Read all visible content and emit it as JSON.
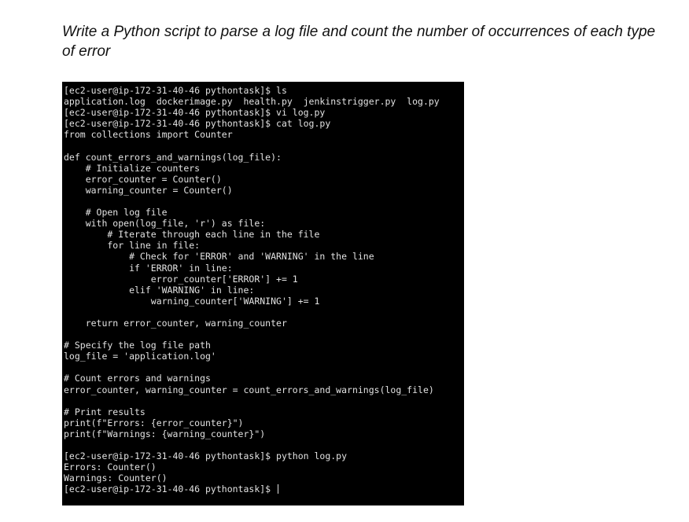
{
  "question": {
    "text": "Write a Python script to parse a log file and count the number of occurrences of each type of error"
  },
  "terminal": {
    "background_color": "#000000",
    "text_color": "#e2e2e2",
    "lines": [
      "[ec2-user@ip-172-31-40-46 pythontask]$ ls",
      "application.log  dockerimage.py  health.py  jenkinstrigger.py  log.py",
      "[ec2-user@ip-172-31-40-46 pythontask]$ vi log.py",
      "[ec2-user@ip-172-31-40-46 pythontask]$ cat log.py",
      "from collections import Counter",
      "",
      "def count_errors_and_warnings(log_file):",
      "    # Initialize counters",
      "    error_counter = Counter()",
      "    warning_counter = Counter()",
      "",
      "    # Open log file",
      "    with open(log_file, 'r') as file:",
      "        # Iterate through each line in the file",
      "        for line in file:",
      "            # Check for 'ERROR' and 'WARNING' in the line",
      "            if 'ERROR' in line:",
      "                error_counter['ERROR'] += 1",
      "            elif 'WARNING' in line:",
      "                warning_counter['WARNING'] += 1",
      "",
      "    return error_counter, warning_counter",
      "",
      "# Specify the log file path",
      "log_file = 'application.log'",
      "",
      "# Count errors and warnings",
      "error_counter, warning_counter = count_errors_and_warnings(log_file)",
      "",
      "# Print results",
      "print(f\"Errors: {error_counter}\")",
      "print(f\"Warnings: {warning_counter}\")",
      "",
      "[ec2-user@ip-172-31-40-46 pythontask]$ python log.py",
      "Errors: Counter()",
      "Warnings: Counter()",
      "[ec2-user@ip-172-31-40-46 pythontask]$ "
    ]
  }
}
